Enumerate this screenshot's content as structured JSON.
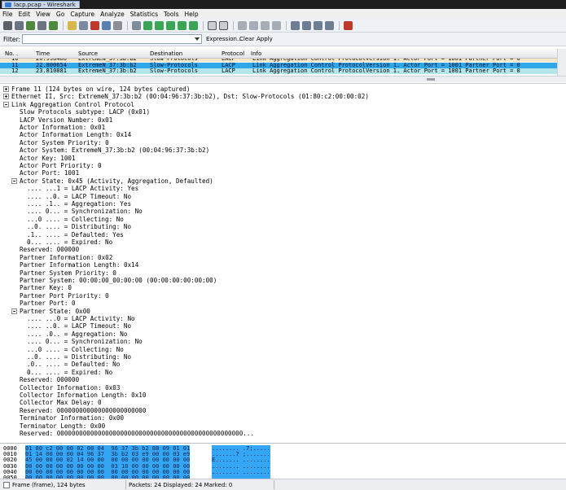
{
  "window": {
    "title": "lacp.pcap - Wireshark"
  },
  "menu": [
    "File",
    "Edit",
    "View",
    "Go",
    "Capture",
    "Analyze",
    "Statistics",
    "Tools",
    "Help"
  ],
  "filter": {
    "label": "Filter:",
    "value": "",
    "expression": "Expression...",
    "clear": "Clear",
    "apply": "Apply"
  },
  "packet_list": {
    "columns": [
      "No. .",
      "Time",
      "Source",
      "Destination",
      "Protocol",
      "Info"
    ],
    "rows": [
      {
        "no": "10",
        "time": "20.998480",
        "src": "ExtremeN_37:3b:b2",
        "dst": "Slow-Protocols",
        "proto": "LACP",
        "info": "Link Aggregation Control ProtocolVersion 1.  Actor Port = 1001 Partner Port = 0",
        "style": "cut"
      },
      {
        "no": "11",
        "time": "22.800654",
        "src": "ExtremeN_37:3b:b2",
        "dst": "Slow-Protocols",
        "proto": "LACP",
        "info": "Link Aggregation Control ProtocolVersion 1.  Actor Port = 1001 Partner Port = 0",
        "style": "sel"
      },
      {
        "no": "12",
        "time": "23.810881",
        "src": "ExtremeN_37:3b:b2",
        "dst": "Slow-Protocols",
        "proto": "LACP",
        "info": "Link Aggregation Control ProtocolVersion 1.  Actor Port = 1001 Partner Port = 0",
        "style": "lacp"
      }
    ]
  },
  "details": [
    {
      "t": "Frame 11 (124 bytes on wire, 124 bytes captured)",
      "l": 0,
      "e": "plus"
    },
    {
      "t": "Ethernet II, Src: ExtremeN_37:3b:b2 (00:04:96:37:3b:b2), Dst: Slow-Protocols (01:80:c2:00:00:02)",
      "l": 0,
      "e": "plus"
    },
    {
      "t": "Link Aggregation Control Protocol",
      "l": 0,
      "e": "minus"
    },
    {
      "t": "Slow Protocols subtype: LACP (0x01)",
      "l": 1
    },
    {
      "t": "LACP Version Number: 0x01",
      "l": 1
    },
    {
      "t": "Actor Information: 0x01",
      "l": 1
    },
    {
      "t": "Actor Information Length: 0x14",
      "l": 1
    },
    {
      "t": "Actor System Priority: 0",
      "l": 1
    },
    {
      "t": "Actor System: ExtremeN_37:3b:b2 (00:04:96:37:3b:b2)",
      "l": 1
    },
    {
      "t": "Actor Key: 1001",
      "l": 1
    },
    {
      "t": "Actor Port Priority: 0",
      "l": 1
    },
    {
      "t": "Actor Port: 1001",
      "l": 1
    },
    {
      "t": "Actor State: 0x45 (Activity, Aggregation, Defaulted)",
      "l": 1,
      "e": "minus"
    },
    {
      "t": ".... ...1 = LACP Activity: Yes",
      "l": 2
    },
    {
      "t": ".... ..0. = LACP Timeout: No",
      "l": 2
    },
    {
      "t": ".... .1.. = Aggregation: Yes",
      "l": 2
    },
    {
      "t": ".... 0... = Synchronization: No",
      "l": 2
    },
    {
      "t": "...0 .... = Collecting: No",
      "l": 2
    },
    {
      "t": "..0. .... = Distributing: No",
      "l": 2
    },
    {
      "t": ".1.. .... = Defaulted: Yes",
      "l": 2
    },
    {
      "t": "0... .... = Expired: No",
      "l": 2
    },
    {
      "t": "Reserved: 000000",
      "l": 1
    },
    {
      "t": "Partner Information: 0x02",
      "l": 1
    },
    {
      "t": "Partner Information Length: 0x14",
      "l": 1
    },
    {
      "t": "Partner System Priority: 0",
      "l": 1
    },
    {
      "t": "Partner System: 00:00:00_00:00:00 (00:00:00:00:00:00)",
      "l": 1
    },
    {
      "t": "Partner Key: 0",
      "l": 1
    },
    {
      "t": "Partner Port Priority: 0",
      "l": 1
    },
    {
      "t": "Partner Port: 0",
      "l": 1
    },
    {
      "t": "Partner State: 0x00",
      "l": 1,
      "e": "minus"
    },
    {
      "t": ".... ...0 = LACP Activity: No",
      "l": 2
    },
    {
      "t": ".... ..0. = LACP Timeout: No",
      "l": 2
    },
    {
      "t": ".... .0.. = Aggregation: No",
      "l": 2
    },
    {
      "t": ".... 0... = Synchronization: No",
      "l": 2
    },
    {
      "t": "...0 .... = Collecting: No",
      "l": 2
    },
    {
      "t": "..0. .... = Distributing: No",
      "l": 2
    },
    {
      "t": ".0.. .... = Defaulted: No",
      "l": 2
    },
    {
      "t": "0... .... = Expired: No",
      "l": 2
    },
    {
      "t": "Reserved: 000000",
      "l": 1
    },
    {
      "t": "Collector Information: 0x03",
      "l": 1
    },
    {
      "t": "Collector Information Length: 0x10",
      "l": 1
    },
    {
      "t": "Collector Max Delay: 0",
      "l": 1
    },
    {
      "t": "Reserved: 000000000000000000000000",
      "l": 1
    },
    {
      "t": "Terminator Information: 0x00",
      "l": 1
    },
    {
      "t": "Terminator Length: 0x00",
      "l": 1
    },
    {
      "t": "Reserved: 00000000000000000000000000000000000000000000000000...",
      "l": 1
    }
  ],
  "bytes": [
    {
      "off": "0000",
      "hex": "01 80 c2 00 00 02 00 04  96 37 3b b2 88 09 01 01",
      "asc": "........ .7;....."
    },
    {
      "off": "0010",
      "hex": "01 14 00 00 00 04 96 37  3b b2 03 e9 00 00 03 e9",
      "asc": ".......7 ;......."
    },
    {
      "off": "0020",
      "hex": "45 00 00 00 02 14 00 00  00 00 00 00 00 00 00 00",
      "asc": "E....... ........"
    },
    {
      "off": "0030",
      "hex": "00 00 00 00 00 00 00 00  03 10 00 00 00 00 00 00",
      "asc": "........ ........"
    },
    {
      "off": "0040",
      "hex": "00 00 00 00 00 00 00 00  00 00 00 00 00 00 00 00",
      "asc": "........ ........"
    },
    {
      "off": "0050",
      "hex": "00 00 00 00 00 00 00 00  00 00 00 00 00 00 00 00",
      "asc": "........ ........"
    }
  ],
  "status": {
    "frame": "Frame (frame), 124 bytes",
    "packets": "Packets: 24 Displayed: 24 Marked: 0"
  },
  "colors": {
    "selected": "#2fa7e8",
    "lacp_row": "#b3e5ea",
    "bytes_highlight": "#35a6f5"
  }
}
